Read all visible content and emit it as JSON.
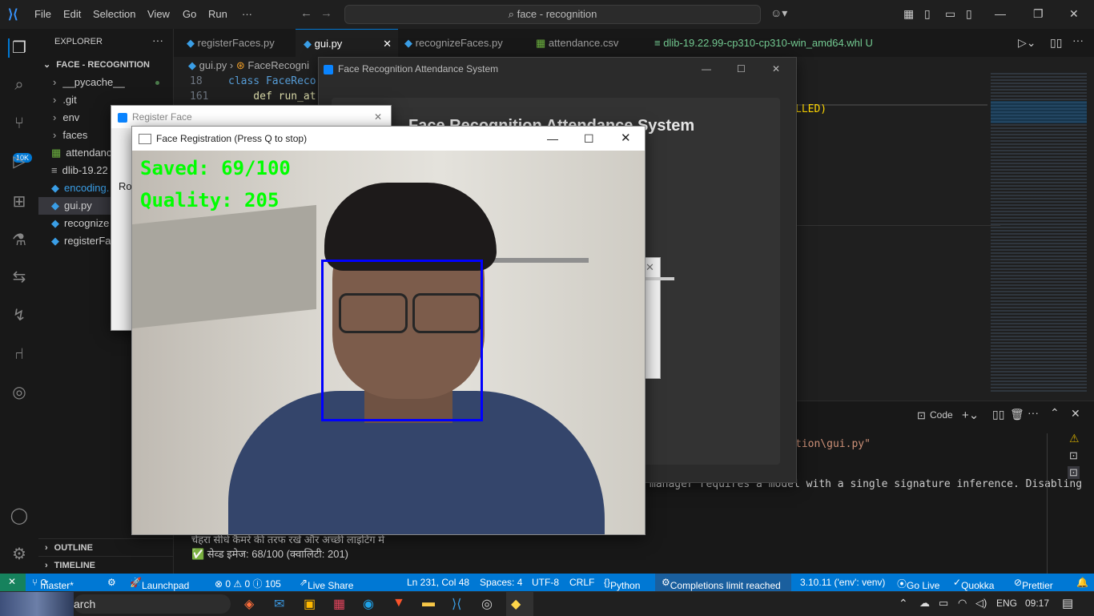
{
  "titlebar": {
    "menu": [
      "File",
      "Edit",
      "Selection",
      "View",
      "Go",
      "Run",
      "···"
    ],
    "search": "face - recognition"
  },
  "sidebar": {
    "header": "EXPLORER",
    "project": "FACE - RECOGNITION",
    "items": [
      {
        "label": "__pycache__",
        "icon": "chevron-right-icon"
      },
      {
        "label": ".git",
        "icon": "chevron-right-icon"
      },
      {
        "label": "env",
        "icon": "chevron-right-icon"
      },
      {
        "label": "faces",
        "icon": "chevron-right-icon"
      },
      {
        "label": "attendanc",
        "icon": "csv-file-icon"
      },
      {
        "label": "dlib-19.22",
        "icon": "file-icon"
      },
      {
        "label": "encoding.",
        "icon": "python-file-icon"
      },
      {
        "label": "gui.py",
        "icon": "python-file-icon"
      },
      {
        "label": "recognize",
        "icon": "python-file-icon"
      },
      {
        "label": "registerFa",
        "icon": "python-file-icon"
      }
    ],
    "outline": "OUTLINE",
    "timeline": "TIMELINE",
    "badge": "10K"
  },
  "tabs": [
    {
      "label": "registerFaces.py"
    },
    {
      "label": "gui.py"
    },
    {
      "label": "recognizeFaces.py"
    },
    {
      "label": "attendance.csv"
    },
    {
      "label": "dlib-19.22.99-cp310-cp310-win_amd64.whl",
      "suffix": "U"
    }
  ],
  "editor": {
    "breadcrumb": [
      "gui.py",
      "FaceRecogni"
    ],
    "lines": [
      {
        "num": "18",
        "text": "class FaceReco"
      },
      {
        "num": "161",
        "text": "    def run_at"
      }
    ],
    "right_fragment": "LLED)"
  },
  "panel": {
    "label": "Code",
    "path_fragment": "tion\\gui.py\"",
    "warning_line": "manager requires a model with a single signature inference. Disabling",
    "hindi_line": "चेहरा सीधे कैमरे की तरफ रखें और अच्छी लाइटिंग में",
    "progress_line": "✅ सेव्ड इमेज: 68/100 (क्वालिटी: 201)"
  },
  "attendance_window": {
    "title": "Face Recognition Attendance System",
    "heading": "Face Recognition Attendance System"
  },
  "register_window": {
    "title": "Register Face",
    "fragment": "Ro"
  },
  "camera_window": {
    "title": "Face Registration (Press Q to stop)",
    "saved": "Saved: 69/100",
    "quality": "Quality: 205"
  },
  "statusbar": {
    "branch": "master*",
    "launchpad": "Launchpad",
    "problems": "⊗ 0 ⚠ 0 ⓘ 105",
    "liveshare": "Live Share",
    "position": "Ln 231, Col 48",
    "spaces": "Spaces: 4",
    "encoding": "UTF-8",
    "eol": "CRLF",
    "language": "Python",
    "completions": "Completions limit reached",
    "interpreter": "3.10.11 ('env': venv)",
    "golive": "Go Live",
    "quokka": "Quokka",
    "prettier": "Prettier"
  },
  "taskbar": {
    "search": "arch",
    "lang": "ENG",
    "time": "09:17"
  },
  "colors": {
    "accent": "#0078d4",
    "overlay_text": "#00ff00",
    "face_box": "#0000ff"
  }
}
